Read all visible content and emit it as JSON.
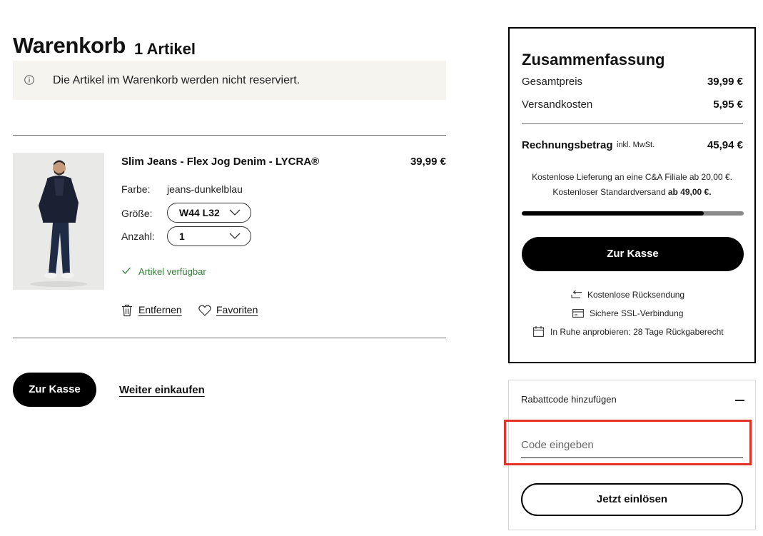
{
  "cart": {
    "title": "Warenkorb",
    "item_count": "1 Artikel",
    "notice": "Die Artikel im Warenkorb werden nicht reserviert."
  },
  "item": {
    "name": "Slim Jeans - Flex Jog Denim - LYCRA®",
    "price": "39,99 €",
    "color_label": "Farbe:",
    "color_value": "jeans-dunkelblau",
    "size_label": "Größe:",
    "size_value": "W44 L32",
    "qty_label": "Anzahl:",
    "qty_value": "1",
    "availability": "Artikel verfügbar",
    "remove_label": "Entfernen",
    "favorite_label": "Favoriten"
  },
  "actions": {
    "checkout_label": "Zur Kasse",
    "continue_label": "Weiter einkaufen"
  },
  "summary": {
    "title": "Zusammenfassung",
    "total_price_label": "Gesamtpreis",
    "total_price_value": "39,99 €",
    "shipping_label": "Versandkosten",
    "shipping_value": "5,95 €",
    "invoice_label": "Rechnungsbetrag",
    "invoice_note": "inkl. MwSt.",
    "invoice_value": "45,94 €",
    "free_delivery_line1": "Kostenlose Lieferung an eine C&A Filiale ab 20,00 €.",
    "free_delivery_line2_prefix": "Kostenloser Standardversand ",
    "free_delivery_line2_bold": "ab 49,00 €.",
    "progress_fraction": 0.82,
    "checkout_label": "Zur Kasse",
    "features": [
      "Kostenlose Rücksendung",
      "Sichere SSL-Verbindung",
      "In Ruhe anprobieren: 28 Tage Rückgaberecht"
    ]
  },
  "coupon": {
    "title": "Rabattcode hinzufügen",
    "placeholder": "Code eingeben",
    "redeem_label": "Jetzt einlösen"
  },
  "colors": {
    "accent": "#000000",
    "notice_bg": "#f6f4ee",
    "available": "#2e7d32",
    "highlight": "#e53229"
  },
  "icons": [
    "info-icon",
    "chevron-down-icon",
    "check-icon",
    "trash-icon",
    "heart-icon",
    "return-arrow-icon",
    "credit-card-icon",
    "calendar-icon",
    "minus-icon"
  ]
}
